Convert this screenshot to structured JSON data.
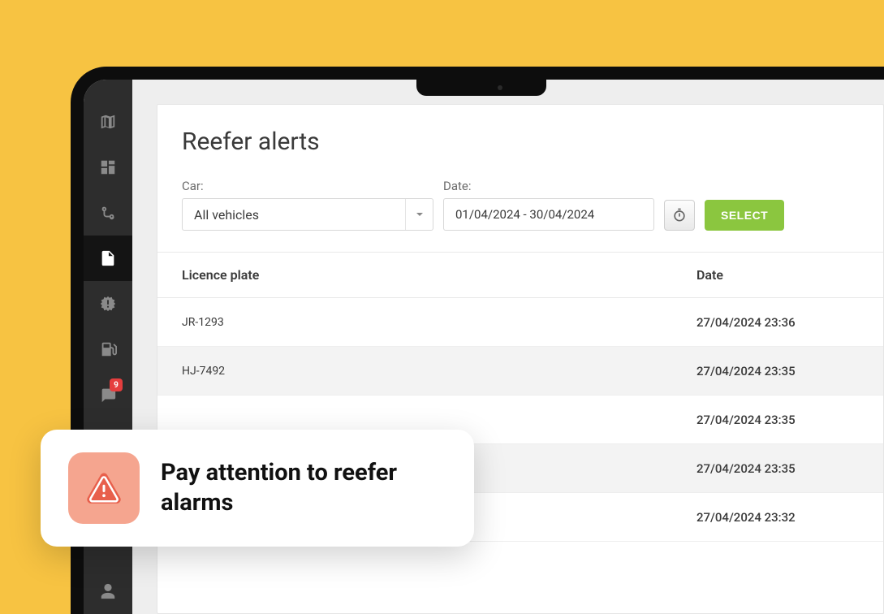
{
  "sidebar": {
    "notification_count": "9"
  },
  "page": {
    "title": "Reefer alerts"
  },
  "filters": {
    "car_label": "Car:",
    "car_value": "All vehicles",
    "date_label": "Date:",
    "date_value": "01/04/2024 - 30/04/2024",
    "select_button": "SELECT"
  },
  "table": {
    "header_plate": "Licence plate",
    "header_date": "Date",
    "rows": [
      {
        "plate": "JR-1293",
        "date": "27/04/2024 23:36"
      },
      {
        "plate": "HJ-7492",
        "date": "27/04/2024 23:35"
      },
      {
        "plate": "",
        "date": "27/04/2024 23:35"
      },
      {
        "plate": "",
        "date": "27/04/2024 23:35"
      },
      {
        "plate": "",
        "date": "27/04/2024 23:32"
      }
    ]
  },
  "toast": {
    "message": "Pay attention to reefer alarms"
  }
}
